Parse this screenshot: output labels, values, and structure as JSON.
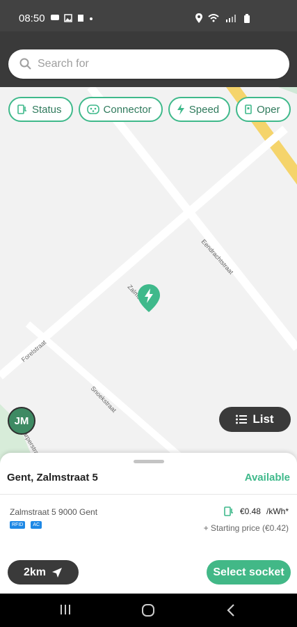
{
  "status_bar": {
    "time": "08:50"
  },
  "search": {
    "placeholder": "Search for"
  },
  "filters": [
    {
      "label": "Status"
    },
    {
      "label": "Connector"
    },
    {
      "label": "Speed"
    },
    {
      "label": "Oper"
    }
  ],
  "map": {
    "streets": [
      "Eendrachtstraat",
      "Zalmstraat",
      "Forelstraat",
      "Snoekstraat",
      "Karperstraat"
    ],
    "avatar_initials": "JM",
    "list_label": "List"
  },
  "station": {
    "title": "Gent, Zalmstraat 5",
    "status": "Available",
    "address": "Zalmstraat 5 9000 Gent",
    "badges": [
      "RFID",
      "AC"
    ],
    "price": "€0.48",
    "price_unit": "/kWh*",
    "starting_price": "+ Starting price (€0.42)"
  },
  "actions": {
    "distance_label": "2km",
    "select_label": "Select socket"
  },
  "colors": {
    "accent": "#42b887",
    "dark": "#3a3a3a",
    "badge": "#1e88e5"
  }
}
